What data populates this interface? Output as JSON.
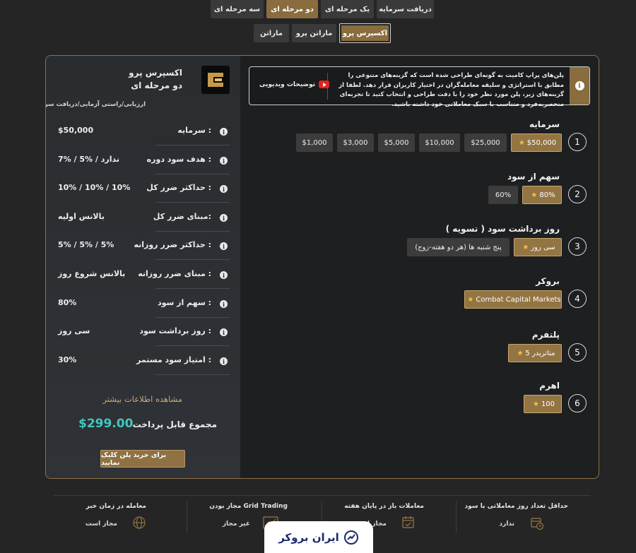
{
  "tabs_top": [
    {
      "label": "دریافت سرمایه",
      "active": false
    },
    {
      "label": "یک مرحله ای",
      "active": false
    },
    {
      "label": "دو مرحله ای",
      "active": true
    },
    {
      "label": "سه مرحله ای",
      "active": false
    }
  ],
  "tabs_sub": [
    {
      "label": "اکسپرس پرو",
      "active": true
    },
    {
      "label": "ماراتن پرو",
      "active": false
    },
    {
      "label": "ماراتن",
      "active": false
    }
  ],
  "sidebar": {
    "plan_name": "اکسپرس پرو",
    "plan_type": "دو مرحله ای",
    "breadcrumb": "ارزیابی/راستی آزمایی/دریافت سرمایه",
    "rows": [
      {
        "label": "سرمایه :",
        "value": "$50,000"
      },
      {
        "label": "هدف سود دوره :",
        "value": "7% / 5% / ندارد"
      },
      {
        "label": "حداکثر ضرر کل :",
        "value": "10% / 10% / 10%"
      },
      {
        "label": "مبنای ضرر کل:",
        "value": "بالانس اولیه"
      },
      {
        "label": "حداکثر ضرر روزانه :",
        "value": "5% / 5% / 5%"
      },
      {
        "label": "مبنای ضرر روزانه :",
        "value": "بالانس شروع روز"
      },
      {
        "label": "سهم از سود :",
        "value": "80%"
      },
      {
        "label": "روز برداشت سود :",
        "value": "سی روز"
      },
      {
        "label": "امتیاز سود مستمر :",
        "value": "30%"
      }
    ],
    "more_info": "مشاهده اطلاعات بیشتر",
    "total_label": "مجموع قابل پرداخت",
    "total_value": "$299.00",
    "buy_button": "برای خرید پلن کلیک نمایید"
  },
  "notice": {
    "text": "پلن‌های پراپ کامیت به گونه‌ای طراحی شده است که گزینه‌های متنوعی را مطابق با استراتژی و سلیقه معامله‌گران در اختیار کاربران قرار دهد. لطفا از گزینه‌های زیر، پلن مورد نظر خود را با دقت طراحی و انتخاب کنید تا تجربه‌ای منحصربه‌فرد و متناسب با سبک معاملاتی خود داشته باشید.",
    "video_label": "توضیحات ویدیویی"
  },
  "sections": [
    {
      "num": "1",
      "title": "سرمایه",
      "options": [
        "$50,000",
        "$25,000",
        "$10,000",
        "$5,000",
        "$3,000",
        "$1,000"
      ],
      "selected": 0
    },
    {
      "num": "2",
      "title": "سهم از سود",
      "options": [
        "80%",
        "60%"
      ],
      "selected": 0
    },
    {
      "num": "3",
      "title": "روز برداشت سود ( تسویه )",
      "options": [
        "سی روز",
        "پنج شنبه ها (هر دو هفته-زوج)"
      ],
      "selected": 0
    },
    {
      "num": "4",
      "title": "بروکر",
      "options": [
        "Combat Capital Markets"
      ],
      "selected": 0
    },
    {
      "num": "5",
      "title": "پلتفرم",
      "options": [
        "متاتریدر 5"
      ],
      "selected": 0
    },
    {
      "num": "6",
      "title": "اهرم",
      "options": [
        "100"
      ],
      "selected": 0
    }
  ],
  "footer": [
    {
      "label": "حداقل تعداد روز معاملاتی با سود",
      "value": "ندارد"
    },
    {
      "label": "معاملات باز در پایان هفته",
      "value": "مجاز است"
    },
    {
      "label": "مجاز بودن Grid Trading",
      "value": "غیر مجاز"
    },
    {
      "label": "معامله در زمان خبر",
      "value": "مجاز است"
    }
  ],
  "watermark": "ایران بروکر",
  "colors": {
    "accent": "#8a6d3e",
    "total": "#3fc9c0",
    "star": "#f3c24a"
  }
}
